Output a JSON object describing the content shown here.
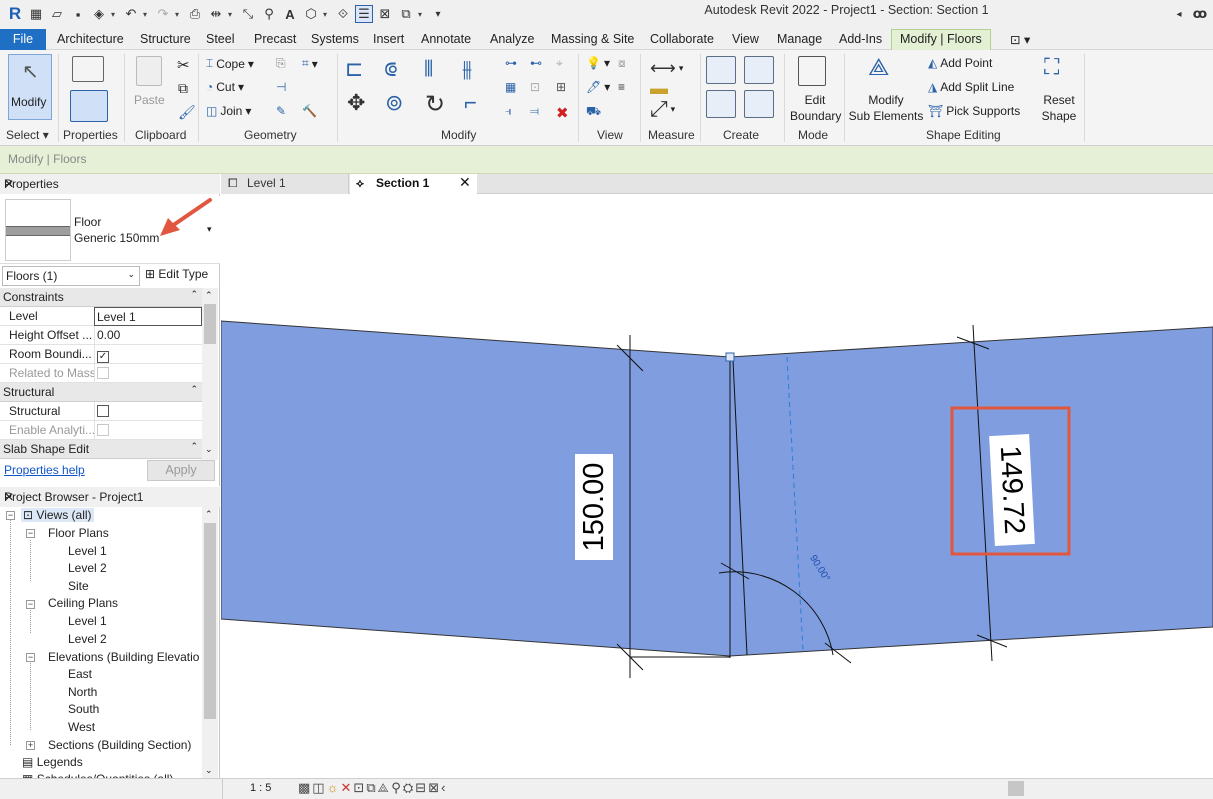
{
  "window": {
    "title": "Autodesk Revit 2022 - Project1 - Section: Section 1"
  },
  "ribbon_tabs": [
    {
      "label": "File"
    },
    {
      "label": "Architecture"
    },
    {
      "label": "Structure"
    },
    {
      "label": "Steel"
    },
    {
      "label": "Precast"
    },
    {
      "label": "Systems"
    },
    {
      "label": "Insert"
    },
    {
      "label": "Annotate"
    },
    {
      "label": "Analyze"
    },
    {
      "label": "Massing & Site"
    },
    {
      "label": "Collaborate"
    },
    {
      "label": "View"
    },
    {
      "label": "Manage"
    },
    {
      "label": "Add-Ins"
    },
    {
      "label": "Modify | Floors",
      "active": true
    }
  ],
  "ribbon": {
    "modify_label": "Modify",
    "paste_label": "Paste",
    "cope_label": "Cope",
    "cut_label": "Cut",
    "join_label": "Join",
    "edit_boundary_line1": "Edit",
    "edit_boundary_line2": "Boundary",
    "modify_sub_line1": "Modify",
    "modify_sub_line2": "Sub Elements",
    "add_point_label": "Add Point",
    "add_split_line_label": "Add Split Line",
    "pick_supports_label": "Pick Supports",
    "reset_shape_line1": "Reset",
    "reset_shape_line2": "Shape",
    "panels": {
      "select": "Select",
      "properties": "Properties",
      "clipboard": "Clipboard",
      "geometry": "Geometry",
      "modify": "Modify",
      "view": "View",
      "measure": "Measure",
      "create": "Create",
      "mode": "Mode",
      "shape_editing": "Shape Editing"
    }
  },
  "context_bar": {
    "label": "Modify | Floors"
  },
  "properties": {
    "header": "Properties",
    "type_family": "Floor",
    "type_name": "Generic 150mm",
    "instance_filter": "Floors (1)",
    "edit_type_label": "Edit Type",
    "groups": {
      "constraints": "Constraints",
      "structural": "Structural",
      "slab_shape_edit": "Slab Shape Edit"
    },
    "rows": {
      "level_key": "Level",
      "level_value": "Level 1",
      "height_offset_key": "Height Offset ...",
      "height_offset_value": "0.00",
      "room_bounding_key": "Room Boundi...",
      "related_to_mass_key": "Related to Mass",
      "structural_key": "Structural",
      "enable_analytical_key": "Enable Analyti..."
    },
    "help_link": "Properties help",
    "apply_label": "Apply"
  },
  "browser": {
    "header": "Project Browser - Project1",
    "views_all": "Views (all)",
    "floor_plans": "Floor Plans",
    "fp_level1": "Level 1",
    "fp_level2": "Level 2",
    "fp_site": "Site",
    "ceiling_plans": "Ceiling Plans",
    "cp_level1": "Level 1",
    "cp_level2": "Level 2",
    "elevations": "Elevations (Building Elevatio",
    "el_east": "East",
    "el_north": "North",
    "el_south": "South",
    "el_west": "West",
    "sections": "Sections (Building Section)",
    "legends": "Legends",
    "schedules": "Schedules/Quantities (all)"
  },
  "view_tabs": [
    {
      "label": "Level 1"
    },
    {
      "label": "Section 1",
      "active": true
    }
  ],
  "canvas": {
    "dim_left": "150.00",
    "dim_right": "149.72",
    "angle": "90.00°",
    "floor_color": "#7f9ddf",
    "highlight_color": "#e0563f"
  },
  "status": {
    "scale": "1 : 5"
  }
}
